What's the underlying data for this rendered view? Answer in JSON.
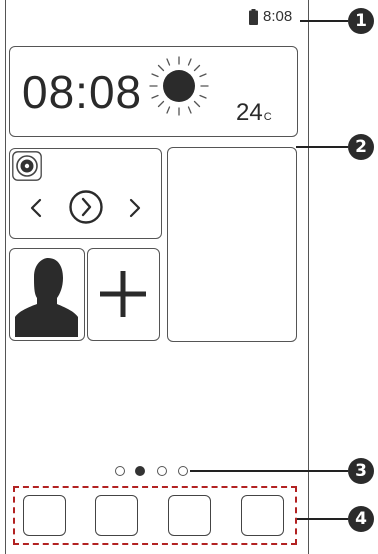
{
  "status_bar": {
    "time": "8:08",
    "battery_icon": "battery-full-icon"
  },
  "clock_widget": {
    "time": "08:08",
    "weather_icon": "sunny-icon",
    "temperature": "24",
    "temperature_unit": "C"
  },
  "music_widget": {
    "app_icon": "music-disc-icon",
    "controls": [
      "previous-icon",
      "play-icon",
      "next-icon"
    ]
  },
  "shortcuts": {
    "contact_icon": "contact-silhouette-icon",
    "add_icon": "plus-icon"
  },
  "page_indicator": {
    "pages": 4,
    "active_page": 2
  },
  "dock": {
    "slot_count": 4
  },
  "callouts": [
    "1",
    "2",
    "3",
    "4"
  ]
}
